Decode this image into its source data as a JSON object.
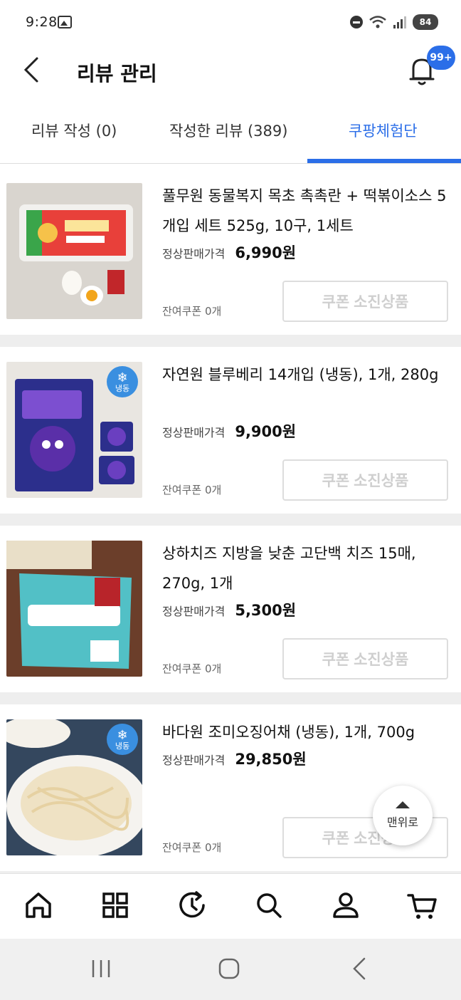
{
  "status_bar": {
    "time": "9:28",
    "battery": "84"
  },
  "header": {
    "title": "리뷰 관리",
    "notification_badge": "99+"
  },
  "tabs": [
    {
      "label": "리뷰 작성 (0)",
      "active": false
    },
    {
      "label": "작성한 리뷰 (389)",
      "active": false
    },
    {
      "label": "쿠팡체험단",
      "active": true
    }
  ],
  "products": [
    {
      "title": "풀무원 동물복지 목초 촉촉란 + 떡볶이소스 5개입 세트 525g, 10구, 1세트",
      "price_label": "정상판매가격",
      "price": "6,990원",
      "remaining": "잔여쿠폰 0개",
      "button": "쿠폰 소진상품",
      "frozen": false
    },
    {
      "title": "자연원 블루베리 14개입 (냉동), 1개, 280g",
      "price_label": "정상판매가격",
      "price": "9,900원",
      "remaining": "잔여쿠폰 0개",
      "button": "쿠폰 소진상품",
      "frozen": true
    },
    {
      "title": "상하치즈 지방을 낮춘 고단백 치즈 15매, 270g, 1개",
      "price_label": "정상판매가격",
      "price": "5,300원",
      "remaining": "잔여쿠폰 0개",
      "button": "쿠폰 소진상품",
      "frozen": false
    },
    {
      "title": "바다원 조미오징어채 (냉동), 1개, 700g",
      "price_label": "정상판매가격",
      "price": "29,850원",
      "remaining": "잔여쿠폰 0개",
      "button": "쿠폰 소진상품",
      "frozen": true
    }
  ],
  "frozen_badge_label": "냉동",
  "scroll_top_label": "맨위로",
  "bottom_nav": {
    "icons": [
      "home-icon",
      "category-icon",
      "recent-icon",
      "search-icon",
      "my-account-icon",
      "cart-icon"
    ]
  },
  "colors": {
    "accent": "#2b6ee8",
    "disabled_text": "#cfcfcf"
  }
}
